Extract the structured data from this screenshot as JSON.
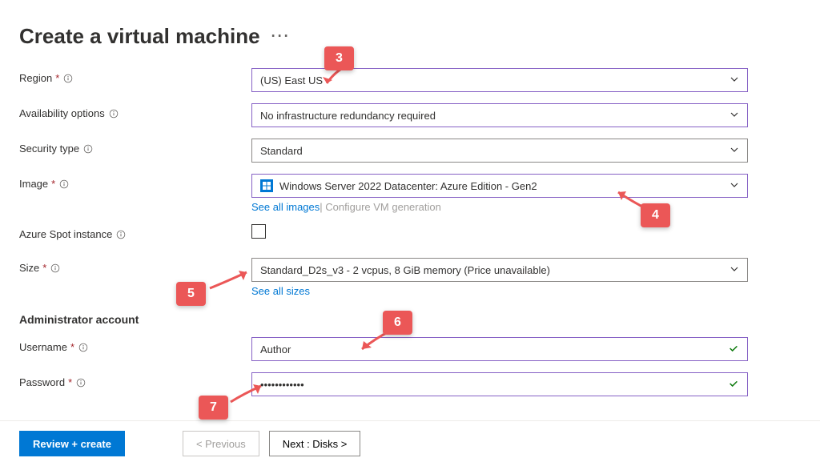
{
  "title": "Create a virtual machine",
  "fields": {
    "region": {
      "label": "Region",
      "value": "(US) East US",
      "required": true
    },
    "availability": {
      "label": "Availability options",
      "value": "No infrastructure redundancy required",
      "required": false
    },
    "security": {
      "label": "Security type",
      "value": "Standard",
      "required": false
    },
    "image": {
      "label": "Image",
      "value": "Windows Server 2022 Datacenter: Azure Edition - Gen2",
      "required": true,
      "see_all": "See all images",
      "configure": "Configure VM generation"
    },
    "spot": {
      "label": "Azure Spot instance",
      "checked": false
    },
    "size": {
      "label": "Size",
      "value": "Standard_D2s_v3 - 2 vcpus, 8 GiB memory (Price unavailable)",
      "required": true,
      "see_all": "See all sizes"
    }
  },
  "admin_section": {
    "heading": "Administrator account",
    "username": {
      "label": "Username",
      "value": "Author",
      "required": true
    },
    "password": {
      "label": "Password",
      "value": "••••••••••••",
      "required": true
    }
  },
  "footer": {
    "review": "Review + create",
    "previous": "< Previous",
    "next": "Next : Disks >"
  },
  "callouts": {
    "c3": "3",
    "c4": "4",
    "c5": "5",
    "c6": "6",
    "c7": "7"
  }
}
